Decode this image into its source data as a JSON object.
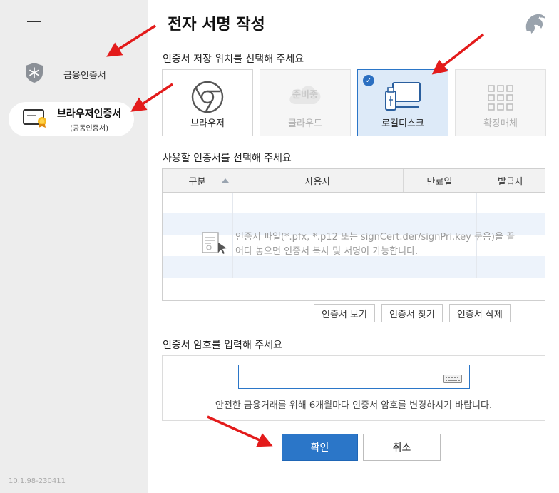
{
  "window": {
    "title": "전자 서명 작성",
    "version": "10.1.98-230411"
  },
  "sidebar": {
    "items": [
      {
        "label": "금융인증서"
      },
      {
        "label": "브라우저인증서",
        "sublabel": "(공동인증서)",
        "selected": true
      }
    ]
  },
  "storage": {
    "heading": "인증서 저장 위치를 선택해 주세요",
    "options": [
      {
        "label": "브라우저",
        "icon": "chrome-icon",
        "state": "enabled"
      },
      {
        "label": "클라우드",
        "badge": "준비중",
        "icon": "cloud-icon",
        "state": "disabled"
      },
      {
        "label": "로컬디스크",
        "icon": "computer-usb-icon",
        "state": "selected"
      },
      {
        "label": "확장매체",
        "icon": "grid-icon",
        "state": "disabled"
      }
    ]
  },
  "cert_list": {
    "heading": "사용할 인증서를 선택해 주세요",
    "columns": [
      "구분",
      "사용자",
      "만료일",
      "발급자"
    ],
    "rows": [],
    "drop_hint": "인증서 파일(*.pfx, *.p12 또는 signCert.der/signPri.key 묶음)을 끌어다 놓으면 인증서 복사 및 서명이 가능합니다."
  },
  "cert_buttons": {
    "view": "인증서 보기",
    "find": "인증서 찾기",
    "delete": "인증서 삭제"
  },
  "password": {
    "heading": "인증서 암호를 입력해 주세요",
    "value": "",
    "note": "안전한 금융거래를 위해 6개월마다 인증서 암호를 변경하시기 바랍니다."
  },
  "actions": {
    "ok": "확인",
    "cancel": "취소"
  },
  "colors": {
    "accent": "#2b76c8",
    "annotation_arrow": "#e31b1b"
  }
}
